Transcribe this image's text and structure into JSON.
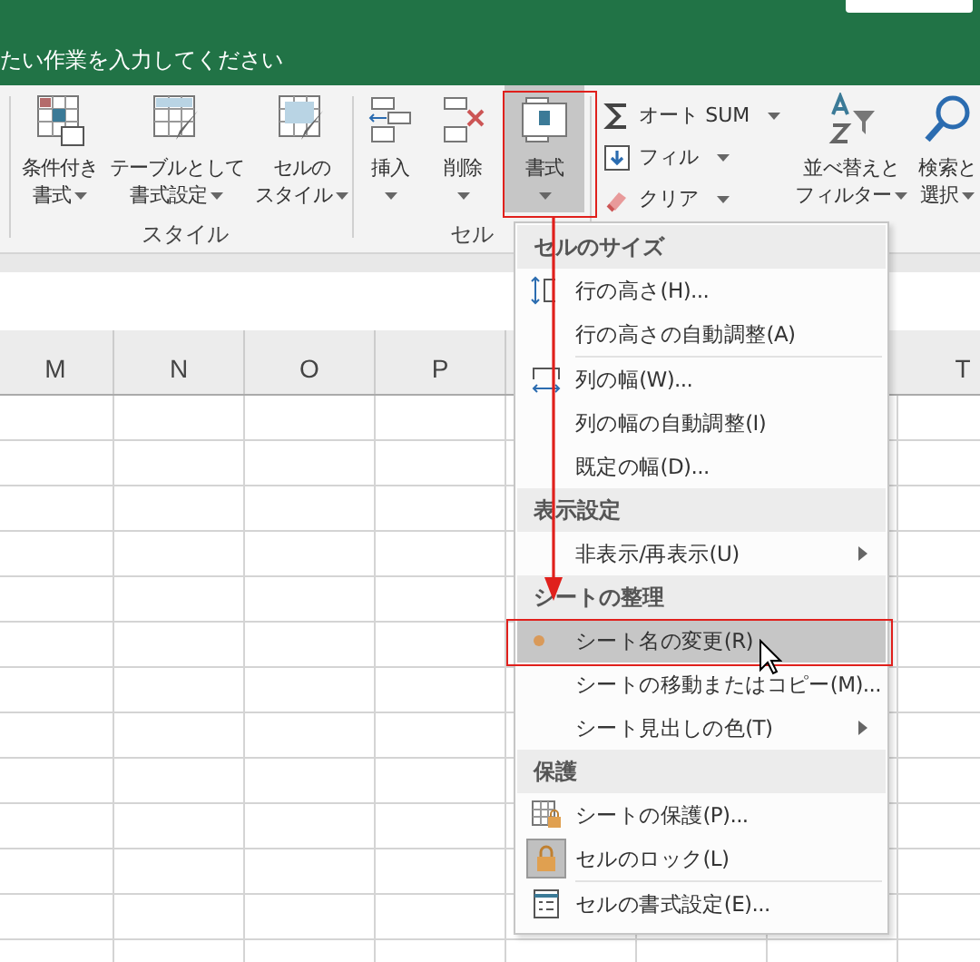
{
  "title_bar": {
    "tell_me": "たい作業を入力してください"
  },
  "ribbon": {
    "groups": [
      {
        "label": "スタイル",
        "buttons": [
          {
            "lines": [
              "条件付き",
              "書式"
            ],
            "dropdown": true,
            "highlighted": false
          },
          {
            "lines": [
              "テーブルとして",
              "書式設定"
            ],
            "dropdown": true,
            "highlighted": false
          },
          {
            "lines": [
              "セルの",
              "スタイル"
            ],
            "dropdown": true,
            "highlighted": false
          }
        ]
      },
      {
        "label": "セル",
        "buttons": [
          {
            "lines": [
              "挿入"
            ],
            "dropdown": true,
            "highlighted": false
          },
          {
            "lines": [
              "削除"
            ],
            "dropdown": true,
            "highlighted": false
          },
          {
            "lines": [
              "書式"
            ],
            "dropdown": true,
            "highlighted": true
          }
        ]
      },
      {
        "stack": [
          {
            "label": "オート SUM",
            "dropdown": true
          },
          {
            "label": "フィル",
            "dropdown": true
          },
          {
            "label": "クリア",
            "dropdown": true
          }
        ],
        "buttons": [
          {
            "lines": [
              "並べ替えと",
              "フィルター"
            ],
            "dropdown": true,
            "highlighted": false
          },
          {
            "lines": [
              "検索と",
              "選択"
            ],
            "dropdown": true,
            "highlighted": false
          }
        ]
      }
    ]
  },
  "sheet": {
    "columns": [
      "M",
      "N",
      "O",
      "P",
      "T"
    ]
  },
  "format_menu": {
    "items": [
      {
        "kind": "header",
        "label": "セルのサイズ"
      },
      {
        "kind": "item",
        "label": "行の高さ(H)...",
        "highlighted": false,
        "submenu": false
      },
      {
        "kind": "item",
        "label": "行の高さの自動調整(A)",
        "highlighted": false,
        "submenu": false
      },
      {
        "kind": "separator"
      },
      {
        "kind": "item",
        "label": "列の幅(W)...",
        "highlighted": false,
        "submenu": false
      },
      {
        "kind": "item",
        "label": "列の幅の自動調整(I)",
        "highlighted": false,
        "submenu": false
      },
      {
        "kind": "item",
        "label": "既定の幅(D)...",
        "highlighted": false,
        "submenu": false
      },
      {
        "kind": "header",
        "label": "表示設定"
      },
      {
        "kind": "item",
        "label": "非表示/再表示(U)",
        "highlighted": false,
        "submenu": true
      },
      {
        "kind": "header",
        "label": "シートの整理"
      },
      {
        "kind": "item",
        "label": "シート名の変更(R)",
        "highlighted": true,
        "submenu": false
      },
      {
        "kind": "item",
        "label": "シートの移動またはコピー(M)...",
        "highlighted": false,
        "submenu": false
      },
      {
        "kind": "item",
        "label": "シート見出しの色(T)",
        "highlighted": false,
        "submenu": true
      },
      {
        "kind": "header",
        "label": "保護"
      },
      {
        "kind": "item",
        "label": "シートの保護(P)...",
        "highlighted": false,
        "submenu": false
      },
      {
        "kind": "item",
        "label": "セルのロック(L)",
        "highlighted": false,
        "checked": true,
        "submenu": false
      },
      {
        "kind": "separator"
      },
      {
        "kind": "item",
        "label": "セルの書式設定(E)...",
        "highlighted": false,
        "submenu": false
      }
    ]
  }
}
